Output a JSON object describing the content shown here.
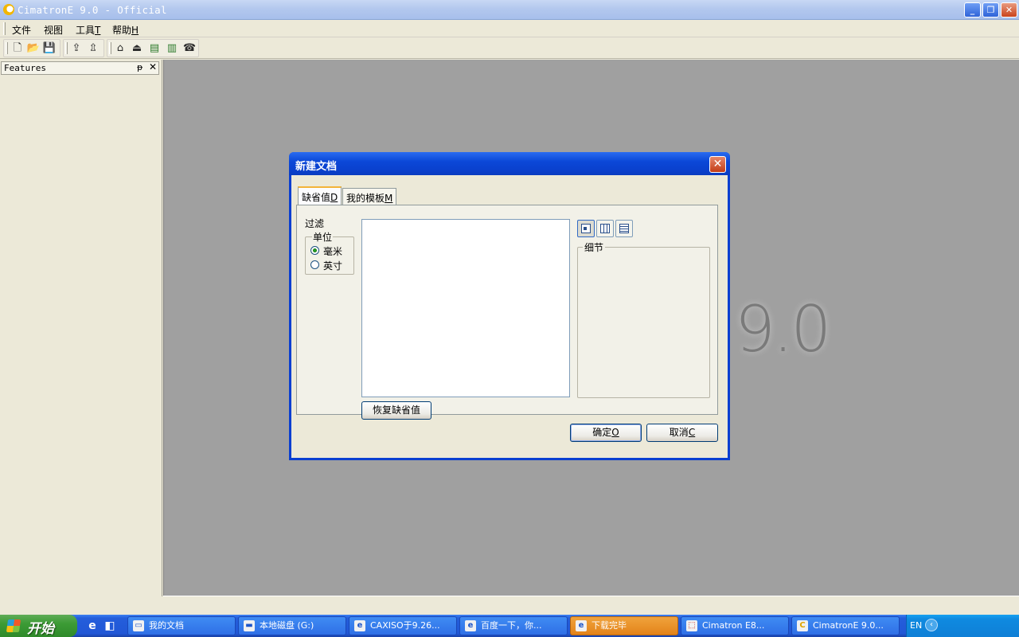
{
  "window": {
    "title": "CimatronE 9.0 - Official"
  },
  "menu": [
    {
      "label": "文件",
      "accel": ""
    },
    {
      "label": "视图",
      "accel": ""
    },
    {
      "label": "工具",
      "accel": "T"
    },
    {
      "label": "帮助",
      "accel": "H"
    }
  ],
  "features_panel": {
    "title": "Features"
  },
  "splash": {
    "version": "9.0"
  },
  "dialog": {
    "title": "新建文档",
    "tabs": [
      {
        "label": "缺省值",
        "accel": "D"
      },
      {
        "label": "我的模板",
        "accel": "M"
      }
    ],
    "filter_label": "过滤",
    "unit_group": {
      "title": "单位",
      "options": [
        {
          "label": "毫米",
          "selected": true
        },
        {
          "label": "英寸",
          "selected": false
        }
      ]
    },
    "detail_label": "细节",
    "restore_button": "恢复缺省值",
    "ok_button": {
      "label": "确定",
      "accel": "O"
    },
    "cancel_button": {
      "label": "取消",
      "accel": "C"
    }
  },
  "taskbar": {
    "start_label": "开始",
    "tasks": [
      {
        "label": "我的文档",
        "active": false
      },
      {
        "label": "本地磁盘 (G:)",
        "active": false
      },
      {
        "label": "CAXISO于9.26...",
        "active": false
      },
      {
        "label": "百度一下，你...",
        "active": false
      },
      {
        "label": "下载完毕",
        "active": true
      },
      {
        "label": "Cimatron E8...",
        "active": false
      },
      {
        "label": "CimatronE 9.0...",
        "active": false
      }
    ],
    "tray": {
      "language": "EN"
    }
  },
  "colors": {
    "xp_blue": "#0a3fd0",
    "workspace_gray": "#a0a0a0",
    "active_task_orange": "#e3831a"
  }
}
